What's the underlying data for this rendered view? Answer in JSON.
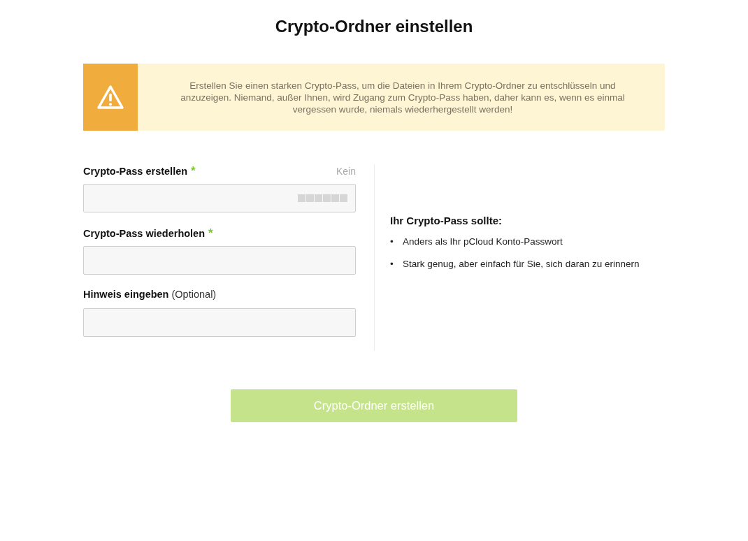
{
  "title": "Crypto-Ordner einstellen",
  "warning": {
    "text": "Erstellen Sie einen starken Crypto-Pass, um die Dateien in Ihrem Crypto-Ordner zu entschlüsseln und anzuzeigen. Niemand, außer Ihnen, wird Zugang zum Crypto-Pass haben, daher kann es, wenn es einmal vergessen wurde, niemals wiederhergestellt werden!"
  },
  "fields": [
    {
      "label": "Crypto-Pass erstellen",
      "marker": "*",
      "strength": {
        "label": "Kein",
        "level": 0
      }
    },
    {
      "label": "Crypto-Pass wiederholen",
      "marker": "*"
    },
    {
      "label": "Hinweis eingeben",
      "note": "(Optional)"
    }
  ],
  "tips": {
    "heading": "Ihr Crypto-Pass sollte:",
    "items": [
      {
        "bullet": "•",
        "text": "Anders als Ihr pCloud Konto-Passwort"
      },
      {
        "bullet": "•",
        "text": "Stark genug, aber einfach für Sie, sich daran zu erinnern"
      }
    ]
  },
  "submit": {
    "label": "Crypto-Ordner erstellen",
    "disabled": true
  }
}
